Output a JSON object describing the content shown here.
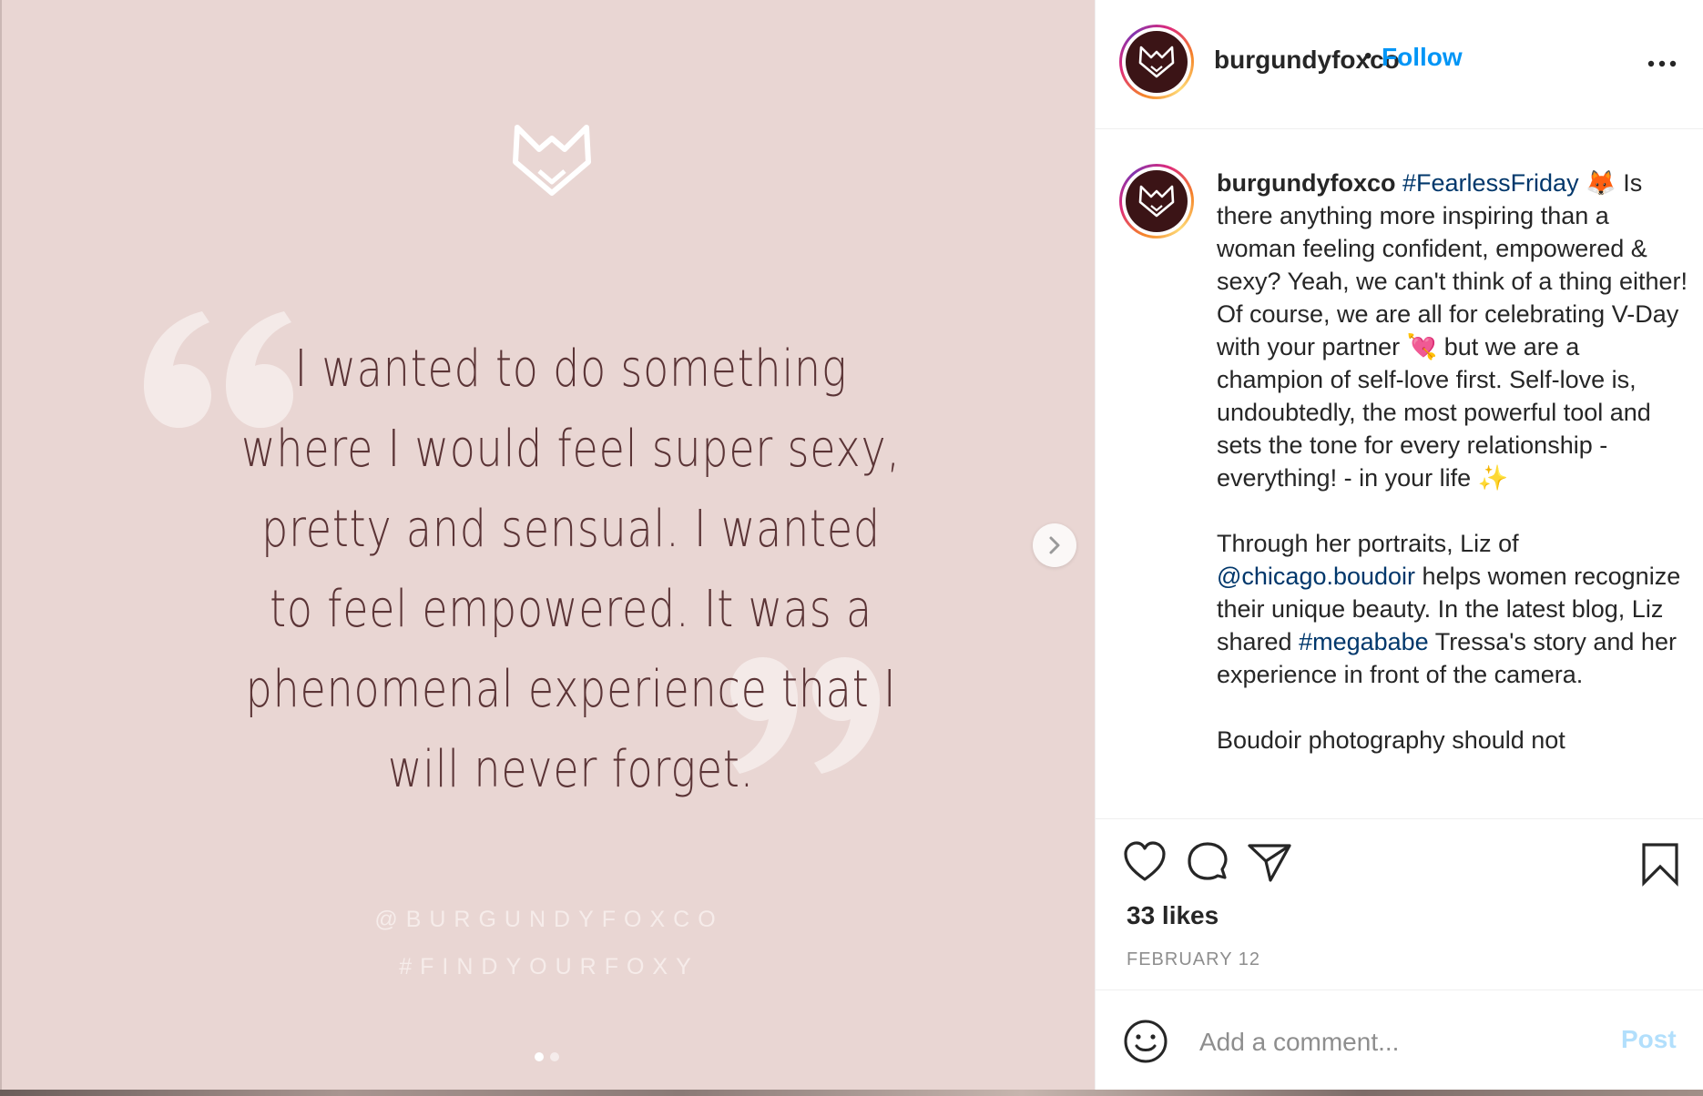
{
  "image": {
    "quote": "I wanted to do something where I would feel super sexy, pretty and sensual. I wanted to feel empowered. It was a phenomenal experience that I will never forget.",
    "handle": "@BURGUNDYFOXCO",
    "hashtag": "#FINDYOURFOXY",
    "carousel_dots": 2,
    "active_dot": 1,
    "colors": {
      "background": "#e9d6d3",
      "quote_text": "#5b3436",
      "quote_marks": "#f3e9e7"
    }
  },
  "header": {
    "username": "burgundyfoxco",
    "separator": "•",
    "follow_label": "Follow"
  },
  "caption": {
    "username": "burgundyfoxco",
    "hashtag1": "#FearlessFriday",
    "fox_emoji": "🦊",
    "part1": " Is there anything more inspiring than a woman feeling confident, empowered & sexy? Yeah, we can't think of a thing either! Of course, we are all for celebrating V-Day with your partner ",
    "heart_emoji": "💘",
    "part2": " but we are a champion of self-love first. Self-love is, undoubtedly, the most powerful tool and sets the tone for every relationship - everything! - in your life ",
    "sparkle_emoji": "✨",
    "part3": "\n\nThrough her portraits, Liz of ",
    "mention": "@chicago.boudoir",
    "part4": " helps women recognize their unique beauty. In the latest blog, Liz shared ",
    "hashtag2": "#megababe",
    "part5": " Tressa's story and her experience in front of the camera.\n\nBoudoir photography should not"
  },
  "actions": {
    "likes": "33 likes",
    "date": "FEBRUARY 12"
  },
  "comment": {
    "placeholder": "Add a comment...",
    "post_label": "Post"
  },
  "icons": {
    "like": "heart-icon",
    "comment": "comment-icon",
    "share": "share-icon",
    "save": "bookmark-icon",
    "emoji": "emoji-icon",
    "more": "more-icon",
    "next": "chevron-right-icon"
  },
  "brand_colors": {
    "link": "#0095f6",
    "hashtag": "#00376b",
    "avatar_bg": "#3b1416"
  }
}
